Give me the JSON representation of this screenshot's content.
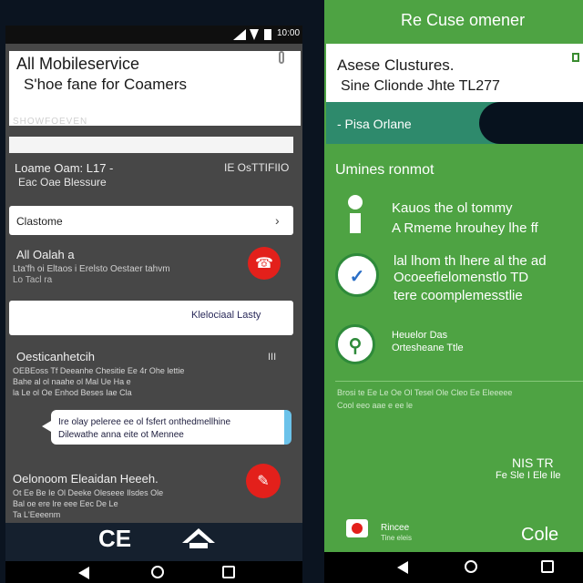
{
  "left": {
    "status": {
      "time": "10:00"
    },
    "header": {
      "title": "All Mobileservice",
      "subtitle": "S'hoe fane for Coamers"
    },
    "small_label": "SHOWFOEVEN",
    "row1": {
      "primary": "Loame Oam: L17 -",
      "secondary": "Eac Oae Blessure",
      "right": "IE OsTTIFIIO"
    },
    "select": {
      "label": "Clastome",
      "chevron": "›"
    },
    "item1": {
      "title": "All Oalah a",
      "sub1": "Lta'fh oi Eltaos i Erelsto Oestaer tahvm",
      "sub2": "Lo Tacl ra"
    },
    "card": {
      "label": "Klelociaal Lasty"
    },
    "item2": {
      "title": "Oesticanhetcih",
      "right": "III",
      "sub1": "OEBEoss Tf Deeanhe Chesitie Ee 4r Ohe lettie",
      "sub2": "Bahe al ol naahe ol Mal Ue Ha e",
      "sub3": "la Le ol Oe Enhod Beses Iae Cla"
    },
    "bubble": {
      "line1": "Ire olay peleree ee ol fsfert onthedmellhine",
      "line2": "Dilewathe anna eite ot Mennee"
    },
    "item3": {
      "title": "Oelonoom Eleaidan Heeeh.",
      "sub1": "Ot Ee Be Ie Ol Deeke Oleseee Ilsdes Ole",
      "sub2": "Bal oe ere lre eee Eec De Le",
      "sub3": "Ta L'Eeeenm"
    },
    "bottom": {
      "logo": "CE"
    }
  },
  "right": {
    "topbar_title": "Re Cuse omener",
    "card": {
      "title": "Asese Clustures.",
      "subtitle": "Sine Clionde Jhte TL277"
    },
    "tab": {
      "label": "- Pisa Orlane"
    },
    "section_title": "Umines ronmot",
    "info": {
      "line1": "Kauos the ol tommy",
      "line2": "A Rmeme hrouhey lhe ff"
    },
    "block1": {
      "line1": "lal lhom th lhere al the ad",
      "line2": "Ocoeefielomenstlo TD",
      "line3": "tere coomplemesstlie"
    },
    "block2": {
      "line1": "Heuelor Das",
      "line2": "Ortesheane Ttle"
    },
    "divider_text": {
      "line1": "Brosi te Ee Le Oe Ol Tesel Ole Cleo Ee Eleeeee",
      "line2": "Cool eeo aae e ee le"
    },
    "footer": {
      "line1": "NIS TR",
      "line2": "Fe Sle I Ele Ile"
    },
    "app": {
      "label1": "Rincee",
      "label2": "Tine eleis"
    },
    "action": "Cole"
  },
  "colors": {
    "left_bg": "#474747",
    "right_bg": "#4ea343",
    "accent_red": "#e3201b",
    "accent_teal": "#2e8a6c"
  },
  "icons": [
    "signal-icon",
    "wifi-icon",
    "battery-icon",
    "edit-icon",
    "chevron-right-icon",
    "mic-icon",
    "home-icon",
    "info-icon",
    "check-icon",
    "pin-icon",
    "back-icon",
    "recent-icon"
  ]
}
